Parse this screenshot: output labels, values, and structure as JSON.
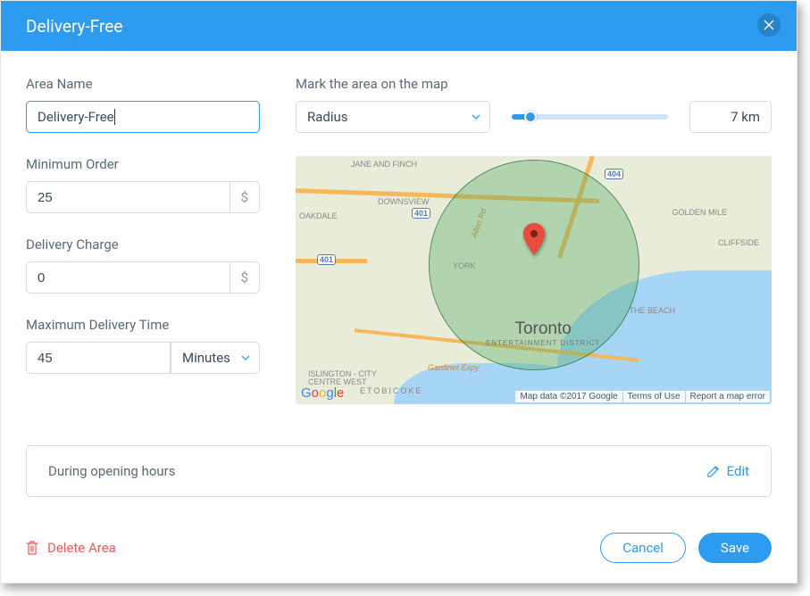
{
  "header": {
    "title": "Delivery-Free"
  },
  "form": {
    "area_name_label": "Area Name",
    "area_name_value": "Delivery-Free",
    "min_order_label": "Minimum Order",
    "min_order_value": "25",
    "currency_symbol": "$",
    "delivery_charge_label": "Delivery Charge",
    "delivery_charge_value": "0",
    "max_time_label": "Maximum Delivery Time",
    "max_time_value": "45",
    "max_time_unit": "Minutes"
  },
  "map_section": {
    "label": "Mark the area on the map",
    "shape_select": "Radius",
    "distance_display": "7 km",
    "city_label": "Toronto",
    "city_sub": "ENTERTAINMENT DISTRICT",
    "labels": {
      "jane_finch": "JANE AND FINCH",
      "downsview": "DOWNSVIEW",
      "york": "YORK",
      "golden_mile": "GOLDEN MILE",
      "cliffside": "CLIFFSIDE",
      "beach": "THE BEACH",
      "etobicoke": "ETOBICOKE",
      "islington": "ISLINGTON - CITY CENTRE WEST",
      "oakdale": "OAKDALE",
      "gardiner": "Gardiner Expy",
      "allen": "Allen Rd",
      "r401a": "401",
      "r401b": "401",
      "r404": "404"
    },
    "attrib": {
      "data": "Map data ©2017 Google",
      "terms": "Terms of Use",
      "report": "Report a map error"
    }
  },
  "hours": {
    "text": "During opening hours",
    "edit_label": "Edit"
  },
  "footer": {
    "delete_label": "Delete Area",
    "cancel_label": "Cancel",
    "save_label": "Save"
  }
}
